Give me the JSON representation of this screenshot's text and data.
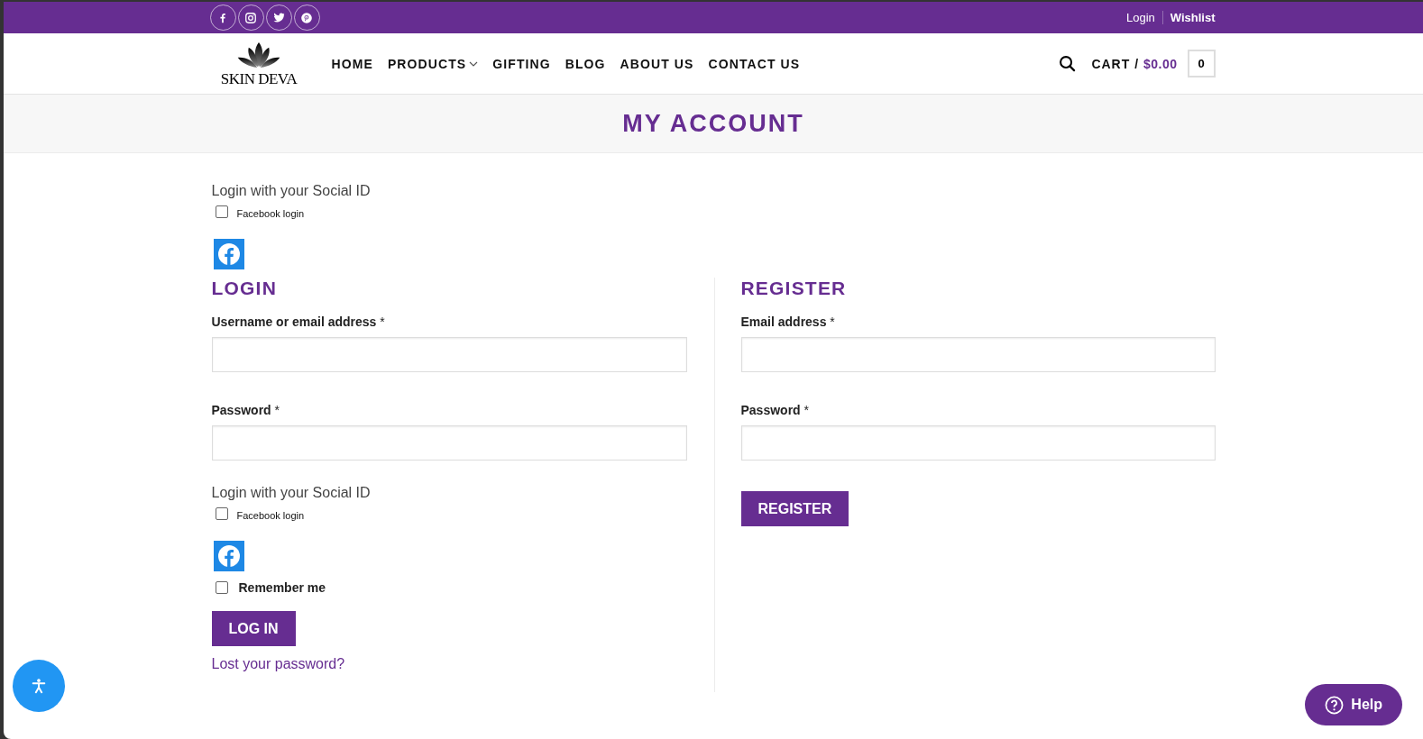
{
  "top_bar": {
    "social_links": [
      {
        "kind": "facebook"
      },
      {
        "kind": "instagram"
      },
      {
        "kind": "twitter"
      },
      {
        "kind": "pinterest"
      }
    ],
    "account_links": [
      "Login",
      "Wishlist"
    ]
  },
  "header": {
    "logo": {
      "text": "SKIN DEVA"
    },
    "nav": [
      {
        "label": "HOME",
        "dropdown": false
      },
      {
        "label": "PRODUCTS",
        "dropdown": true
      },
      {
        "label": "GIFTING",
        "dropdown": false
      },
      {
        "label": "BLOG",
        "dropdown": false
      },
      {
        "label": "ABOUT US",
        "dropdown": false
      },
      {
        "label": "CONTACT US",
        "dropdown": false
      }
    ],
    "cart": {
      "label": "CART /",
      "amount": "$0.00",
      "count": "0"
    }
  },
  "page_title": "MY ACCOUNT",
  "social_login": {
    "heading": "Login with your Social ID",
    "checkbox": {
      "label": "Facebook login",
      "checked": false
    }
  },
  "login": {
    "title": "LOGIN",
    "fields": [
      {
        "label": "Username or email address",
        "required": "*"
      },
      {
        "label": "Password",
        "required": "*"
      }
    ],
    "social_login": {
      "heading": "Login with your Social ID",
      "checkbox": {
        "label": "Facebook login",
        "checked": false
      }
    },
    "remember": {
      "label": "Remember me",
      "checked": false
    },
    "button": "LOG IN",
    "lost_password": "Lost your password?"
  },
  "register": {
    "title": "REGISTER",
    "fields": [
      {
        "label": "Email address",
        "required": "*"
      },
      {
        "label": "Password",
        "required": "*"
      }
    ],
    "button": "REGISTER"
  },
  "help_button": {
    "label": "Help"
  }
}
